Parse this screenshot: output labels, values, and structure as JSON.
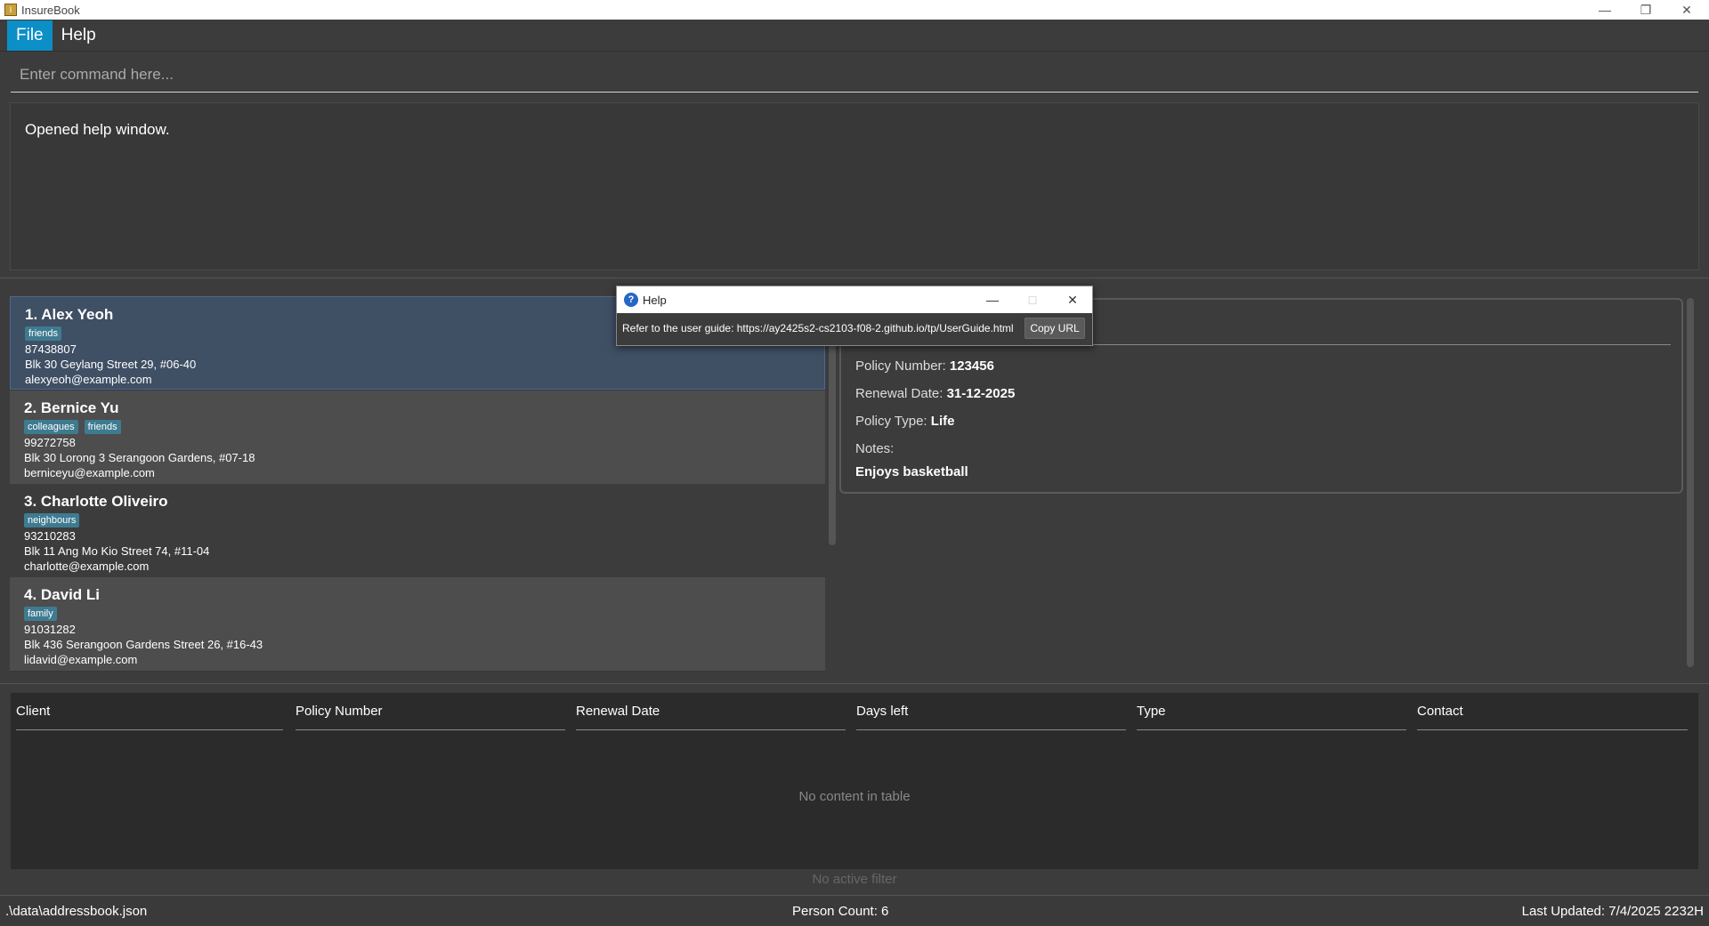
{
  "window": {
    "title": "InsureBook",
    "icon": "app-icon"
  },
  "menu": {
    "file": "File",
    "help": "Help"
  },
  "command": {
    "placeholder": "Enter command here..."
  },
  "result": {
    "message": "Opened help window."
  },
  "persons": [
    {
      "name": "1. Alex Yeoh",
      "tags": [
        "friends"
      ],
      "phone": "87438807",
      "address": "Blk 30 Geylang Street 29, #06-40",
      "email": "alexyeoh@example.com"
    },
    {
      "name": "2. Bernice Yu",
      "tags": [
        "colleagues",
        "friends"
      ],
      "phone": "99272758",
      "address": "Blk 30 Lorong 3 Serangoon Gardens, #07-18",
      "email": "berniceyu@example.com"
    },
    {
      "name": "3. Charlotte Oliveiro",
      "tags": [
        "neighbours"
      ],
      "phone": "93210283",
      "address": "Blk 11 Ang Mo Kio Street 74, #11-04",
      "email": "charlotte@example.com"
    },
    {
      "name": "4. David Li",
      "tags": [
        "family"
      ],
      "phone": "91031282",
      "address": "Blk 436 Serangoon Gardens Street 26, #16-43",
      "email": "lidavid@example.com"
    }
  ],
  "detail": {
    "policy_number_label": "Policy Number:",
    "policy_number": "123456",
    "renewal_label": "Renewal Date:",
    "renewal": "31-12-2025",
    "type_label": "Policy Type:",
    "type": "Life",
    "notes_label": "Notes:",
    "notes": "Enjoys basketball"
  },
  "table": {
    "columns": [
      "Client",
      "Policy Number",
      "Renewal Date",
      "Days left",
      "Type",
      "Contact"
    ],
    "empty_text": "No content in table"
  },
  "filter_text": "No active filter",
  "status": {
    "path": ".\\data\\addressbook.json",
    "count": "Person Count: 6",
    "updated": "Last Updated: 7/4/2025 2232H"
  },
  "help_dialog": {
    "title": "Help",
    "message": "Refer to the user guide: https://ay2425s2-cs2103-f08-2.github.io/tp/UserGuide.html",
    "copy_label": "Copy URL"
  }
}
